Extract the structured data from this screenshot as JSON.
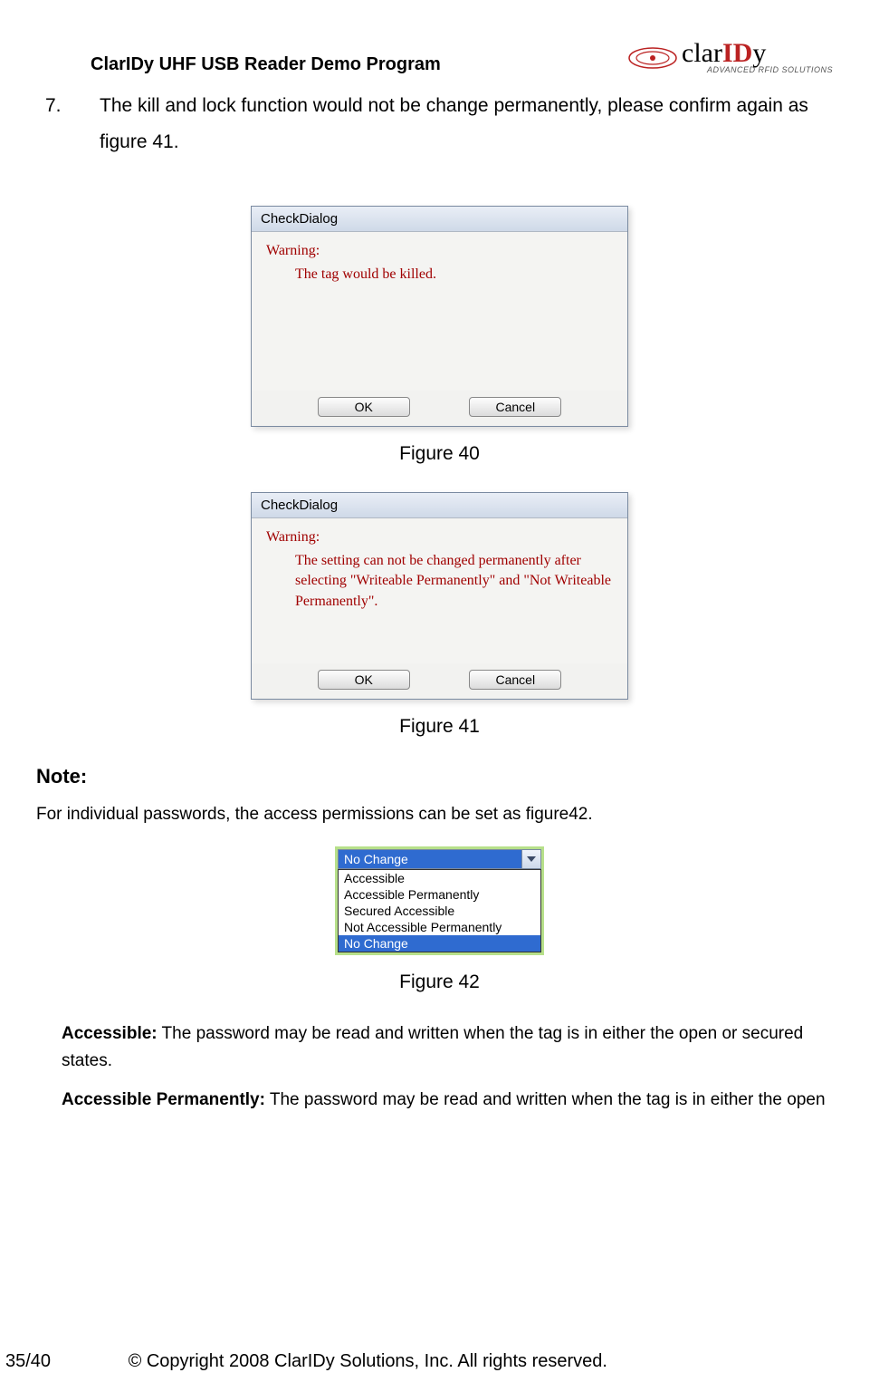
{
  "header": {
    "doc_title": "ClarIDy UHF USB Reader Demo Program",
    "logo_main": "clarIDy",
    "logo_sub": "ADVANCED RFID SOLUTIONS"
  },
  "list_item": {
    "number": "7.",
    "text": "The kill and lock function would not be change permanently, please confirm again as figure 41."
  },
  "dialog1": {
    "title": "CheckDialog",
    "warn_header": "Warning:",
    "warn_msg": "The tag would be killed.",
    "ok": "OK",
    "cancel": "Cancel"
  },
  "caption1": "Figure 40",
  "dialog2": {
    "title": "CheckDialog",
    "warn_header": "Warning:",
    "warn_msg": "The setting can not be changed permanently after selecting \"Writeable Permanently\" and \"Not Writeable Permanently\".",
    "ok": "OK",
    "cancel": "Cancel"
  },
  "caption2": "Figure 41",
  "note": {
    "heading": "Note:",
    "text": "For individual passwords, the access permissions can be set as figure42."
  },
  "dropdown": {
    "selected": "No Change",
    "options": [
      "Accessible",
      "Accessible Permanently",
      "Secured Accessible",
      "Not Accessible Permanently",
      "No Change"
    ],
    "highlight_index": 4
  },
  "caption3": "Figure 42",
  "definitions": [
    {
      "term": "Accessible:",
      "text": " The password may be read and written when the tag is in either the open or secured states."
    },
    {
      "term": "Accessible Permanently:",
      "text": " The password may be read and written when the tag is in either the open"
    }
  ],
  "footer": {
    "page": "35/40",
    "copyright": "© Copyright 2008 ClarIDy Solutions, Inc. All rights reserved."
  }
}
